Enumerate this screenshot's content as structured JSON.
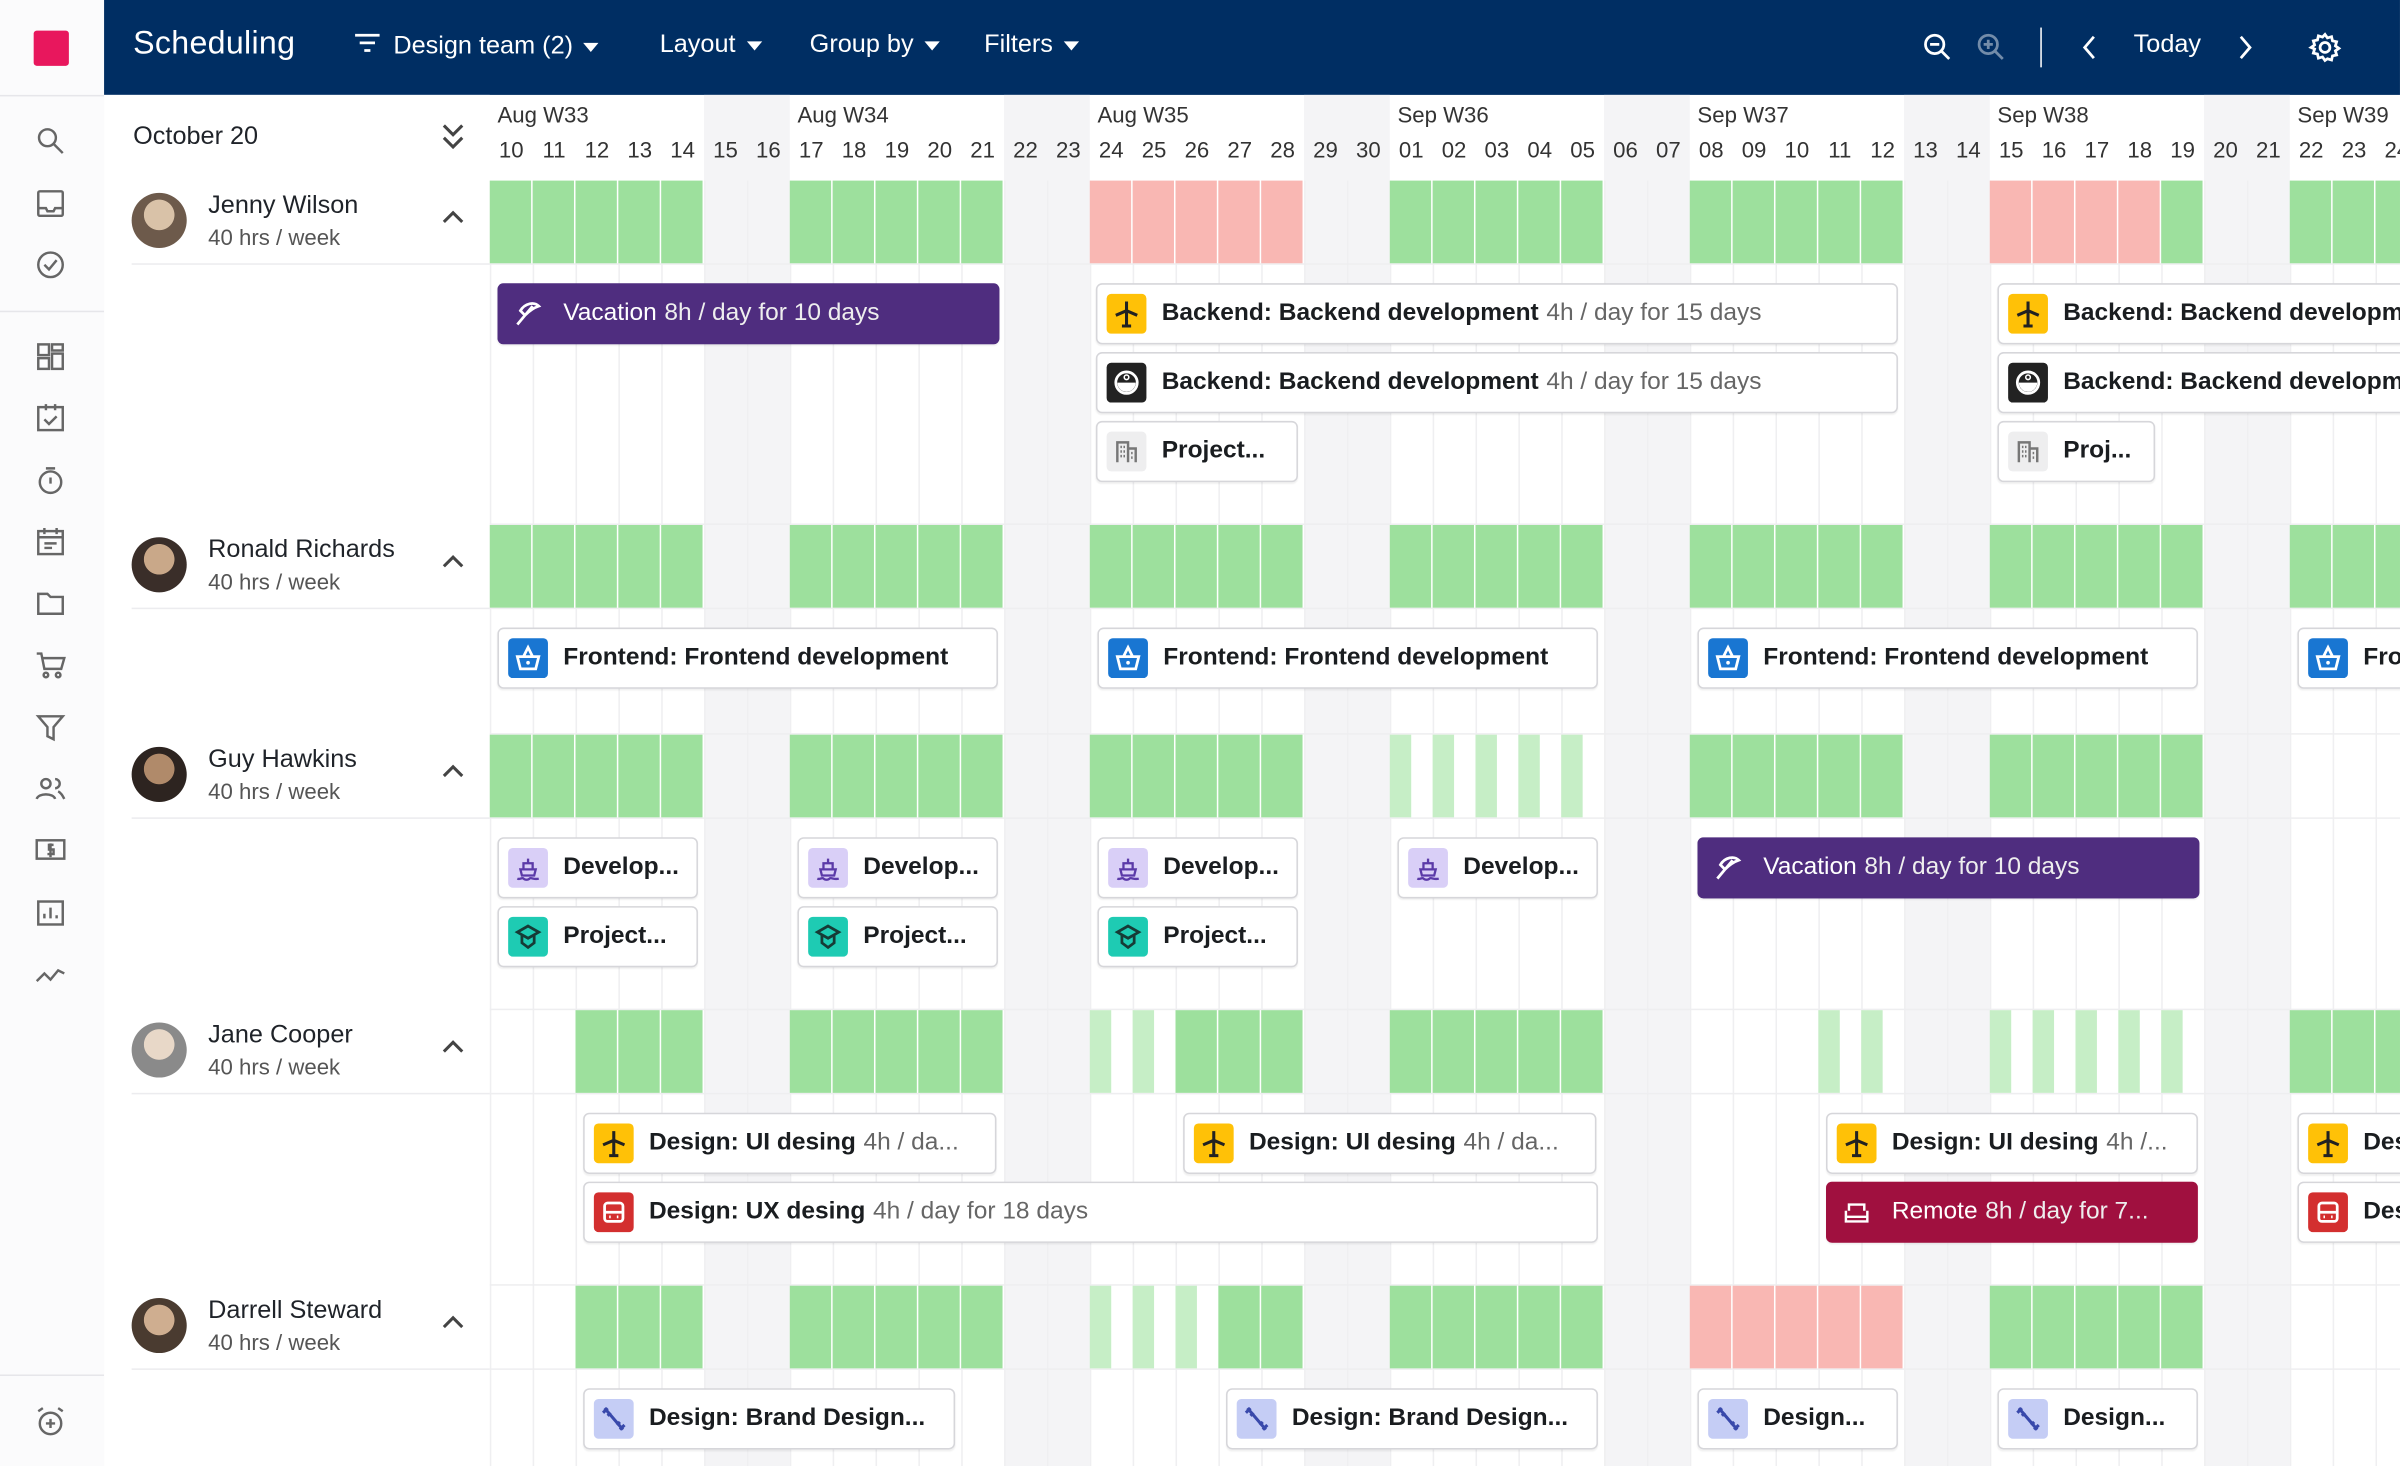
{
  "app": {
    "title": "Scheduling"
  },
  "toolbar": {
    "team_filter": "Design team (2)",
    "layout": "Layout",
    "group_by": "Group by",
    "filters": "Filters",
    "today": "Today"
  },
  "sidebar": {
    "icons": [
      "search-icon",
      "inbox-icon",
      "check-circle-icon",
      "dashboard-icon",
      "clipboard-check-icon",
      "stopwatch-icon",
      "calendar-icon",
      "folder-icon",
      "cart-icon",
      "funnel-icon",
      "people-icon",
      "billing-icon",
      "report-icon",
      "trend-icon"
    ],
    "bottom_icon": "alarm-add-icon"
  },
  "colors": {
    "header": "#002e63",
    "logo": "#e8175d",
    "available": "#9de09d",
    "partial": "#c6eec6",
    "overbooked": "#f9b7b3",
    "vacation": "#4f2d7f",
    "remote": "#a0103f"
  },
  "calendar": {
    "current_label": "October 20",
    "weeks": [
      "Aug W33",
      "Aug W34",
      "Aug W35",
      "Sep W36",
      "Sep W37",
      "Sep W38",
      "Sep W39"
    ],
    "days": [
      "10",
      "11",
      "12",
      "13",
      "14",
      "15",
      "16",
      "17",
      "18",
      "19",
      "20",
      "21",
      "22",
      "23",
      "24",
      "25",
      "26",
      "27",
      "28",
      "29",
      "30",
      "01",
      "02",
      "03",
      "04",
      "05",
      "06",
      "07",
      "08",
      "09",
      "10",
      "11",
      "12",
      "13",
      "14",
      "15",
      "16",
      "17",
      "18",
      "19",
      "20",
      "21",
      "22",
      "23",
      "24"
    ]
  },
  "availability_legend": {
    "g": "available",
    "l": "partially available",
    "r": "overbooked",
    ".": "none"
  },
  "people": [
    {
      "name": "Jenny Wilson",
      "hours": "40 hrs / week",
      "availability": "ggggg..ggggg..rrrrr..ggggg..ggggg..rrrrg..ggg",
      "cards": [
        {
          "icon": "umbrella",
          "title": "Vacation",
          "detail": "8h / day for 10 days",
          "style": "vacation"
        },
        {
          "icon": "plane",
          "title": "Backend: Backend development",
          "detail": "4h / day for 15 days"
        },
        {
          "icon": "face",
          "title": "Backend: Backend development",
          "detail": "4h / day for 15 days"
        },
        {
          "icon": "building",
          "title": "Project...",
          "detail": ""
        },
        {
          "icon": "plane",
          "title": "Backend: Backend developm",
          "detail": ""
        },
        {
          "icon": "face",
          "title": "Backend: Backend developm",
          "detail": ""
        },
        {
          "icon": "building",
          "title": "Proj...",
          "detail": ""
        }
      ]
    },
    {
      "name": "Ronald Richards",
      "hours": "40 hrs / week",
      "availability": "ggggg..ggggg..ggggg..ggggg..ggggg..ggggg..ggg",
      "cards": [
        {
          "icon": "basket",
          "title": "Frontend: Frontend development",
          "detail": ""
        },
        {
          "icon": "basket",
          "title": "Frontend: Frontend development",
          "detail": ""
        },
        {
          "icon": "basket",
          "title": "Frontend: Frontend development",
          "detail": ""
        },
        {
          "icon": "basket",
          "title": "Fro",
          "detail": ""
        }
      ]
    },
    {
      "name": "Guy Hawkins",
      "hours": "40 hrs / week",
      "availability": "ggggg..ggggg..ggggg..lllll..ggggg..ggggg.....",
      "cards": [
        {
          "icon": "ship",
          "title": "Develop...",
          "detail": ""
        },
        {
          "icon": "ship",
          "title": "Develop...",
          "detail": ""
        },
        {
          "icon": "ship",
          "title": "Develop...",
          "detail": ""
        },
        {
          "icon": "ship",
          "title": "Develop...",
          "detail": ""
        },
        {
          "icon": "cap",
          "title": "Project...",
          "detail": ""
        },
        {
          "icon": "cap",
          "title": "Project...",
          "detail": ""
        },
        {
          "icon": "cap",
          "title": "Project...",
          "detail": ""
        },
        {
          "icon": "umbrella",
          "title": "Vacation",
          "detail": "8h / day for 10 days",
          "style": "vacation"
        }
      ]
    },
    {
      "name": "Jane Cooper",
      "hours": "40 hrs / week",
      "availability": "..ggg..ggggg..llggg..ggggg.....ll..lllll..ggg",
      "cards": [
        {
          "icon": "plane",
          "title": "Design: UI desing",
          "detail": "4h / da..."
        },
        {
          "icon": "plane",
          "title": "Design: UI desing",
          "detail": "4h / da..."
        },
        {
          "icon": "plane",
          "title": "Design: UI desing",
          "detail": "4h /..."
        },
        {
          "icon": "plane",
          "title": "Des",
          "detail": ""
        },
        {
          "icon": "car",
          "title": "Design: UX desing",
          "detail": "4h / day for 18 days"
        },
        {
          "icon": "sofa",
          "title": "Remote",
          "detail": "8h / day for 7...",
          "style": "remote"
        },
        {
          "icon": "car",
          "title": "Des",
          "detail": ""
        }
      ]
    },
    {
      "name": "Darrell Steward",
      "hours": "40 hrs / week",
      "availability": "..ggg..ggggg..lllgg..ggggg..rrrrr..ggggg.....",
      "cards": [
        {
          "icon": "dumbbell",
          "title": "Design: Brand Design...",
          "detail": ""
        },
        {
          "icon": "dumbbell",
          "title": "Design: Brand Design...",
          "detail": ""
        },
        {
          "icon": "dumbbell",
          "title": "Design...",
          "detail": ""
        },
        {
          "icon": "dumbbell",
          "title": "Design...",
          "detail": ""
        }
      ]
    }
  ]
}
